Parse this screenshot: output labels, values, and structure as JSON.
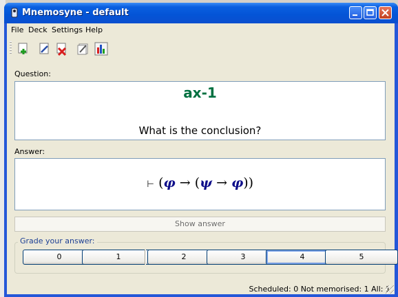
{
  "window": {
    "title": "Mnemosyne - default"
  },
  "menu": {
    "items": [
      "File",
      "Deck",
      "Settings",
      "Help"
    ]
  },
  "toolbar": {
    "icons": [
      "add-card-icon",
      "edit-card-icon",
      "delete-card-icon",
      "edit-deck-icon",
      "statistics-icon"
    ]
  },
  "question": {
    "label": "Question:",
    "title": "ax-1",
    "text": "What is the conclusion?"
  },
  "answer": {
    "label": "Answer:",
    "turnstile": "⊢",
    "formula": [
      "(",
      "φ",
      " → ",
      "(",
      "ψ",
      " → ",
      "φ",
      "))"
    ]
  },
  "show_answer": {
    "label": "Show answer"
  },
  "grades": {
    "title": "Grade your answer:",
    "buttons": [
      "0",
      "1",
      "2",
      "3",
      "4",
      "5"
    ],
    "focused": "4"
  },
  "status": {
    "text": "Scheduled: 0  Not memorised: 1  All: 1"
  },
  "colors": {
    "title_bar": "#0454d6",
    "question_title": "#007040",
    "formula_greek": "#0d0d8a"
  }
}
